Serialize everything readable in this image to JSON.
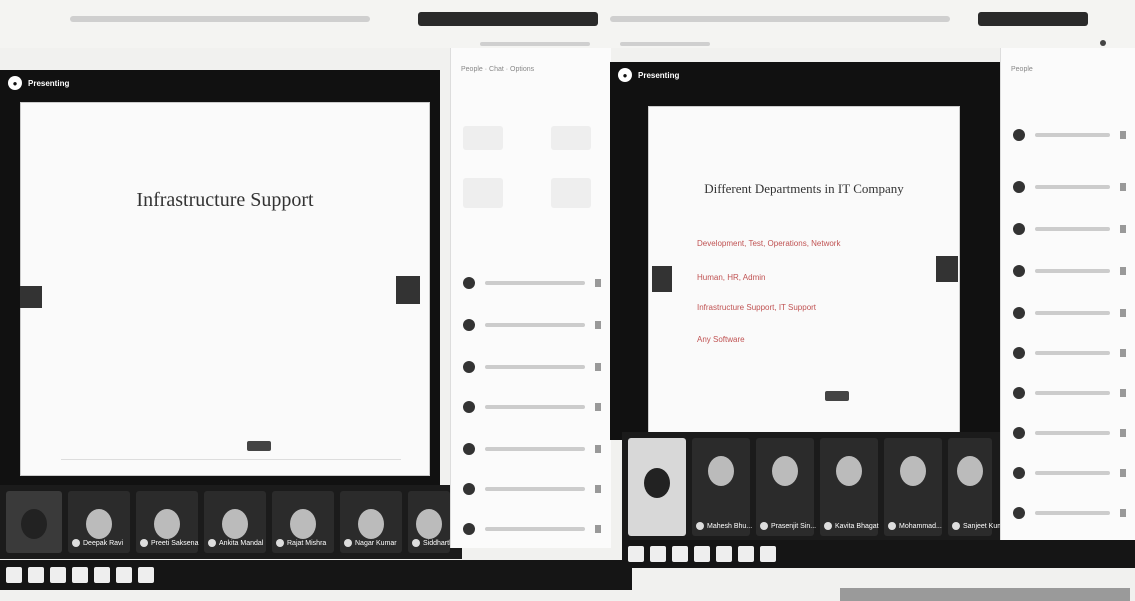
{
  "left_meeting": {
    "title": "Infrastructure Support",
    "participants": [
      {
        "name": "Deepak Ravi"
      },
      {
        "name": "Preeti Saksena"
      },
      {
        "name": "Ankita Mandal"
      },
      {
        "name": "Rajat Mishra"
      },
      {
        "name": "Nagar Kumar"
      },
      {
        "name": "Siddharth Na..."
      }
    ]
  },
  "right_meeting": {
    "slide_title": "Different Departments in IT Company",
    "slide_lines": [
      "Development, Test, Operations, Network",
      "Human, HR, Admin",
      "Infrastructure Support, IT Support",
      "Any Software"
    ],
    "participants": [
      {
        "name": "Mahesh Bhu..."
      },
      {
        "name": "Prasenjit Sin..."
      },
      {
        "name": "Kavita Bhagat"
      },
      {
        "name": "Mohammad..."
      },
      {
        "name": "Sanjeet Kumar"
      }
    ]
  },
  "colors": {
    "meeting_bg": "#111111",
    "slide_bg": "#fafafa",
    "accent_red": "#c05353"
  },
  "icons": {
    "presenter_logo": "presenter-logo-icon",
    "mic": "mic-icon",
    "taskbar_app": "taskbar-app-icon"
  }
}
